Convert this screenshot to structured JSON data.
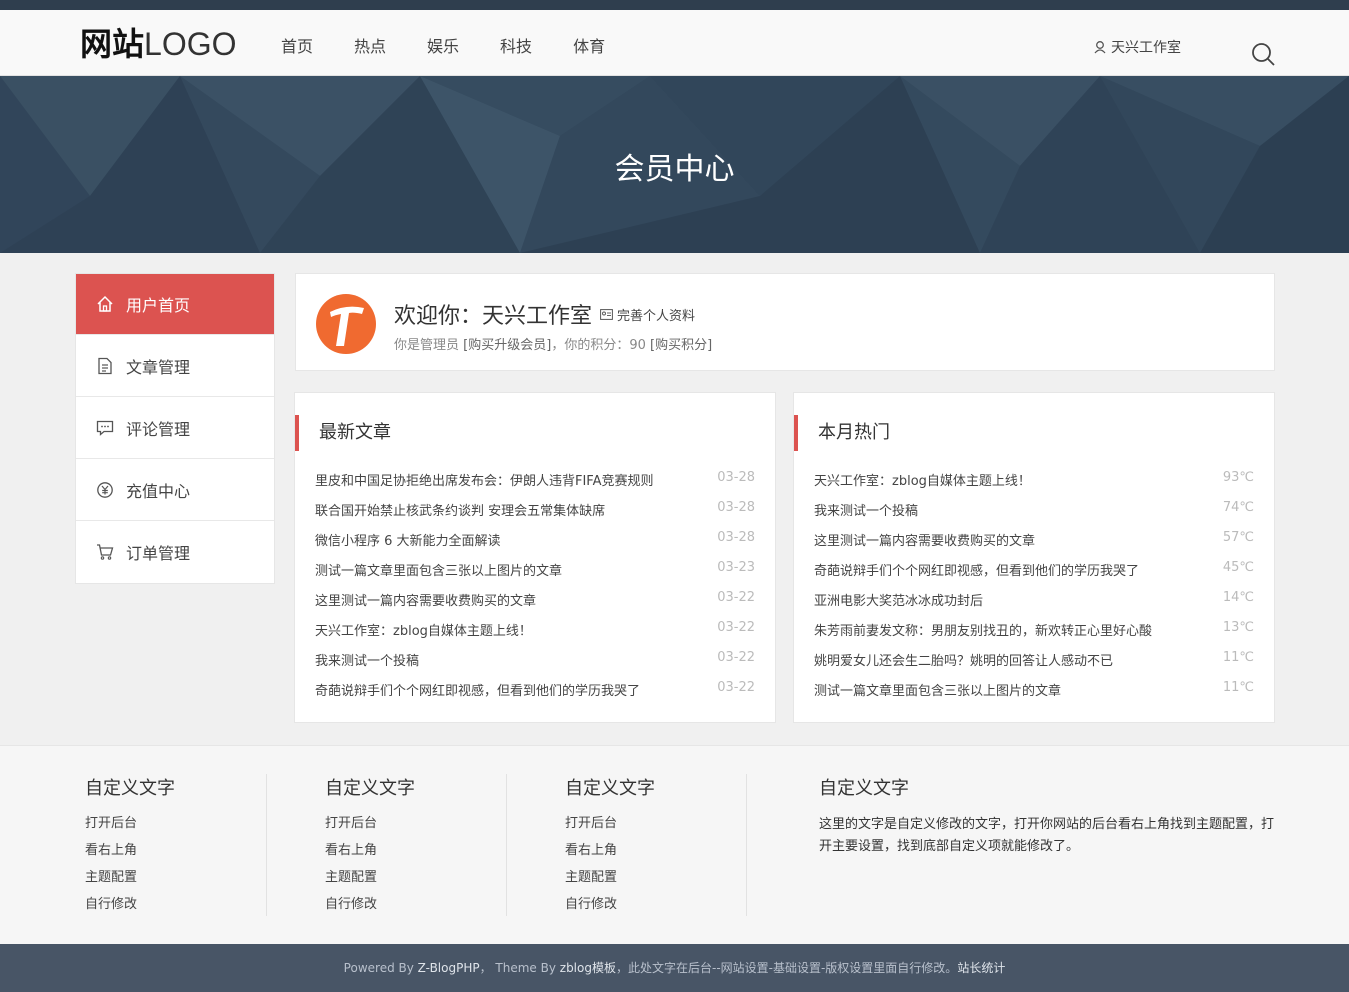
{
  "header": {
    "logo_bold": "网站",
    "logo_light": "LOGO",
    "nav": [
      "首页",
      "热点",
      "娱乐",
      "科技",
      "体育"
    ],
    "user": "天兴工作室"
  },
  "banner": {
    "title": "会员中心"
  },
  "sidebar": {
    "items": [
      {
        "label": "用户首页",
        "icon": "home-icon"
      },
      {
        "label": "文章管理",
        "icon": "document-icon"
      },
      {
        "label": "评论管理",
        "icon": "comment-icon"
      },
      {
        "label": "充值中心",
        "icon": "coin-icon"
      },
      {
        "label": "订单管理",
        "icon": "cart-icon"
      }
    ]
  },
  "welcome": {
    "title": "欢迎你：天兴工作室",
    "edit_label": "完善个人资料",
    "role_text": "你是管理员",
    "upgrade_link": "[购买升级会员]",
    "points_text": "，你的积分：90",
    "buy_points_link": "[购买积分]"
  },
  "latest": {
    "title": "最新文章",
    "items": [
      {
        "title": "里皮和中国足协拒绝出席发布会：伊朗人违背FIFA竞赛规则",
        "date": "03-28"
      },
      {
        "title": "联合国开始禁止核武条约谈判 安理会五常集体缺席",
        "date": "03-28"
      },
      {
        "title": "微信小程序 6 大新能力全面解读",
        "date": "03-28"
      },
      {
        "title": "测试一篇文章里面包含三张以上图片的文章",
        "date": "03-23"
      },
      {
        "title": "这里测试一篇内容需要收费购买的文章",
        "date": "03-22"
      },
      {
        "title": "天兴工作室：zblog自媒体主题上线！",
        "date": "03-22"
      },
      {
        "title": "我来测试一个投稿",
        "date": "03-22"
      },
      {
        "title": "奇葩说辩手们个个网红即视感，但看到他们的学历我哭了",
        "date": "03-22"
      }
    ]
  },
  "hot": {
    "title": "本月热门",
    "items": [
      {
        "title": "天兴工作室：zblog自媒体主题上线！",
        "heat": "93℃"
      },
      {
        "title": "我来测试一个投稿",
        "heat": "74℃"
      },
      {
        "title": "这里测试一篇内容需要收费购买的文章",
        "heat": "57℃"
      },
      {
        "title": "奇葩说辩手们个个网红即视感，但看到他们的学历我哭了",
        "heat": "45℃"
      },
      {
        "title": "亚洲电影大奖范冰冰成功封后",
        "heat": "14℃"
      },
      {
        "title": "朱芳雨前妻发文称：男朋友别找丑的，新欢转正心里好心酸",
        "heat": "13℃"
      },
      {
        "title": "姚明爱女儿还会生二胎吗？姚明的回答让人感动不已",
        "heat": "11℃"
      },
      {
        "title": "测试一篇文章里面包含三张以上图片的文章",
        "heat": "11℃"
      }
    ]
  },
  "footer": {
    "columns": [
      {
        "title": "自定义文字",
        "links": [
          "打开后台",
          "看右上角",
          "主题配置",
          "自行修改"
        ]
      },
      {
        "title": "自定义文字",
        "links": [
          "打开后台",
          "看右上角",
          "主题配置",
          "自行修改"
        ]
      },
      {
        "title": "自定义文字",
        "links": [
          "打开后台",
          "看右上角",
          "主题配置",
          "自行修改"
        ]
      }
    ],
    "text_title": "自定义文字",
    "text_body": "这里的文字是自定义修改的文字，打开你网站的后台看右上角找到主题配置，打开主要设置，找到底部自定义项就能修改了。",
    "copyright": {
      "powered": "Powered By ",
      "zblog": "Z-BlogPHP",
      "theme": "， Theme By ",
      "theme_name": "zblog模板",
      "note": "，此处文字在后台--网站设置-基础设置-版权设置里面自行修改。",
      "stats": "站长统计"
    }
  }
}
